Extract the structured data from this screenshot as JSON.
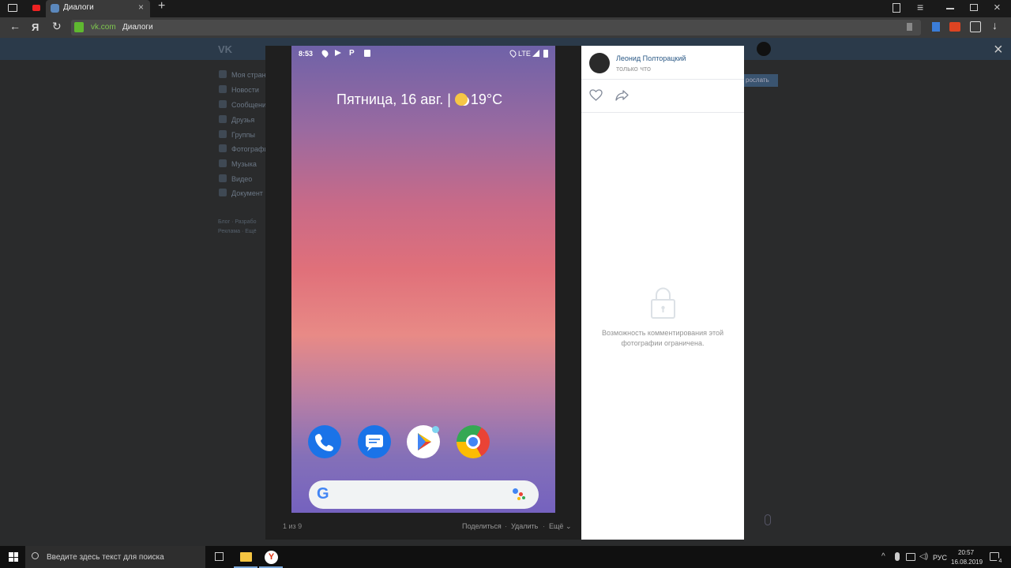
{
  "browser": {
    "tab_title": "Диалоги",
    "yandex_letter": "Я",
    "url_domain": "vk.com",
    "url_page": "Диалоги"
  },
  "vk": {
    "sidebar": [
      {
        "label": "Моя страни"
      },
      {
        "label": "Новости"
      },
      {
        "label": "Сообщени"
      },
      {
        "label": "Друзья"
      },
      {
        "label": "Группы"
      },
      {
        "label": "Фотографи"
      },
      {
        "label": "Музыка"
      },
      {
        "label": "Видео"
      },
      {
        "label": "Документ"
      }
    ],
    "footer_links_1": "Блог · Разрабо",
    "footer_links_2": "Реклама · Ещё",
    "bg_button": "рослать"
  },
  "phone": {
    "time": "8:53",
    "network": "LTE",
    "date_weather": "Пятница, 16 авг. | ",
    "temperature": "19°C",
    "search_g": "G"
  },
  "viewer": {
    "counter": "1 из 9",
    "share": "Поделиться",
    "delete": "Удалить",
    "more": "Ещё",
    "sep": "·"
  },
  "panel": {
    "author": "Леонид Полторацкий",
    "time": "только что",
    "comments_closed": "Возможность комментирования этой фотографии ограничена."
  },
  "taskbar": {
    "search_placeholder": "Введите здесь текст для поиска",
    "lang": "РУС",
    "clock_time": "20:57",
    "clock_date": "16.08.2019",
    "notif_count": "4"
  },
  "colors": {
    "vk_link": "#2a5885",
    "accent_green": "#5fb830"
  }
}
